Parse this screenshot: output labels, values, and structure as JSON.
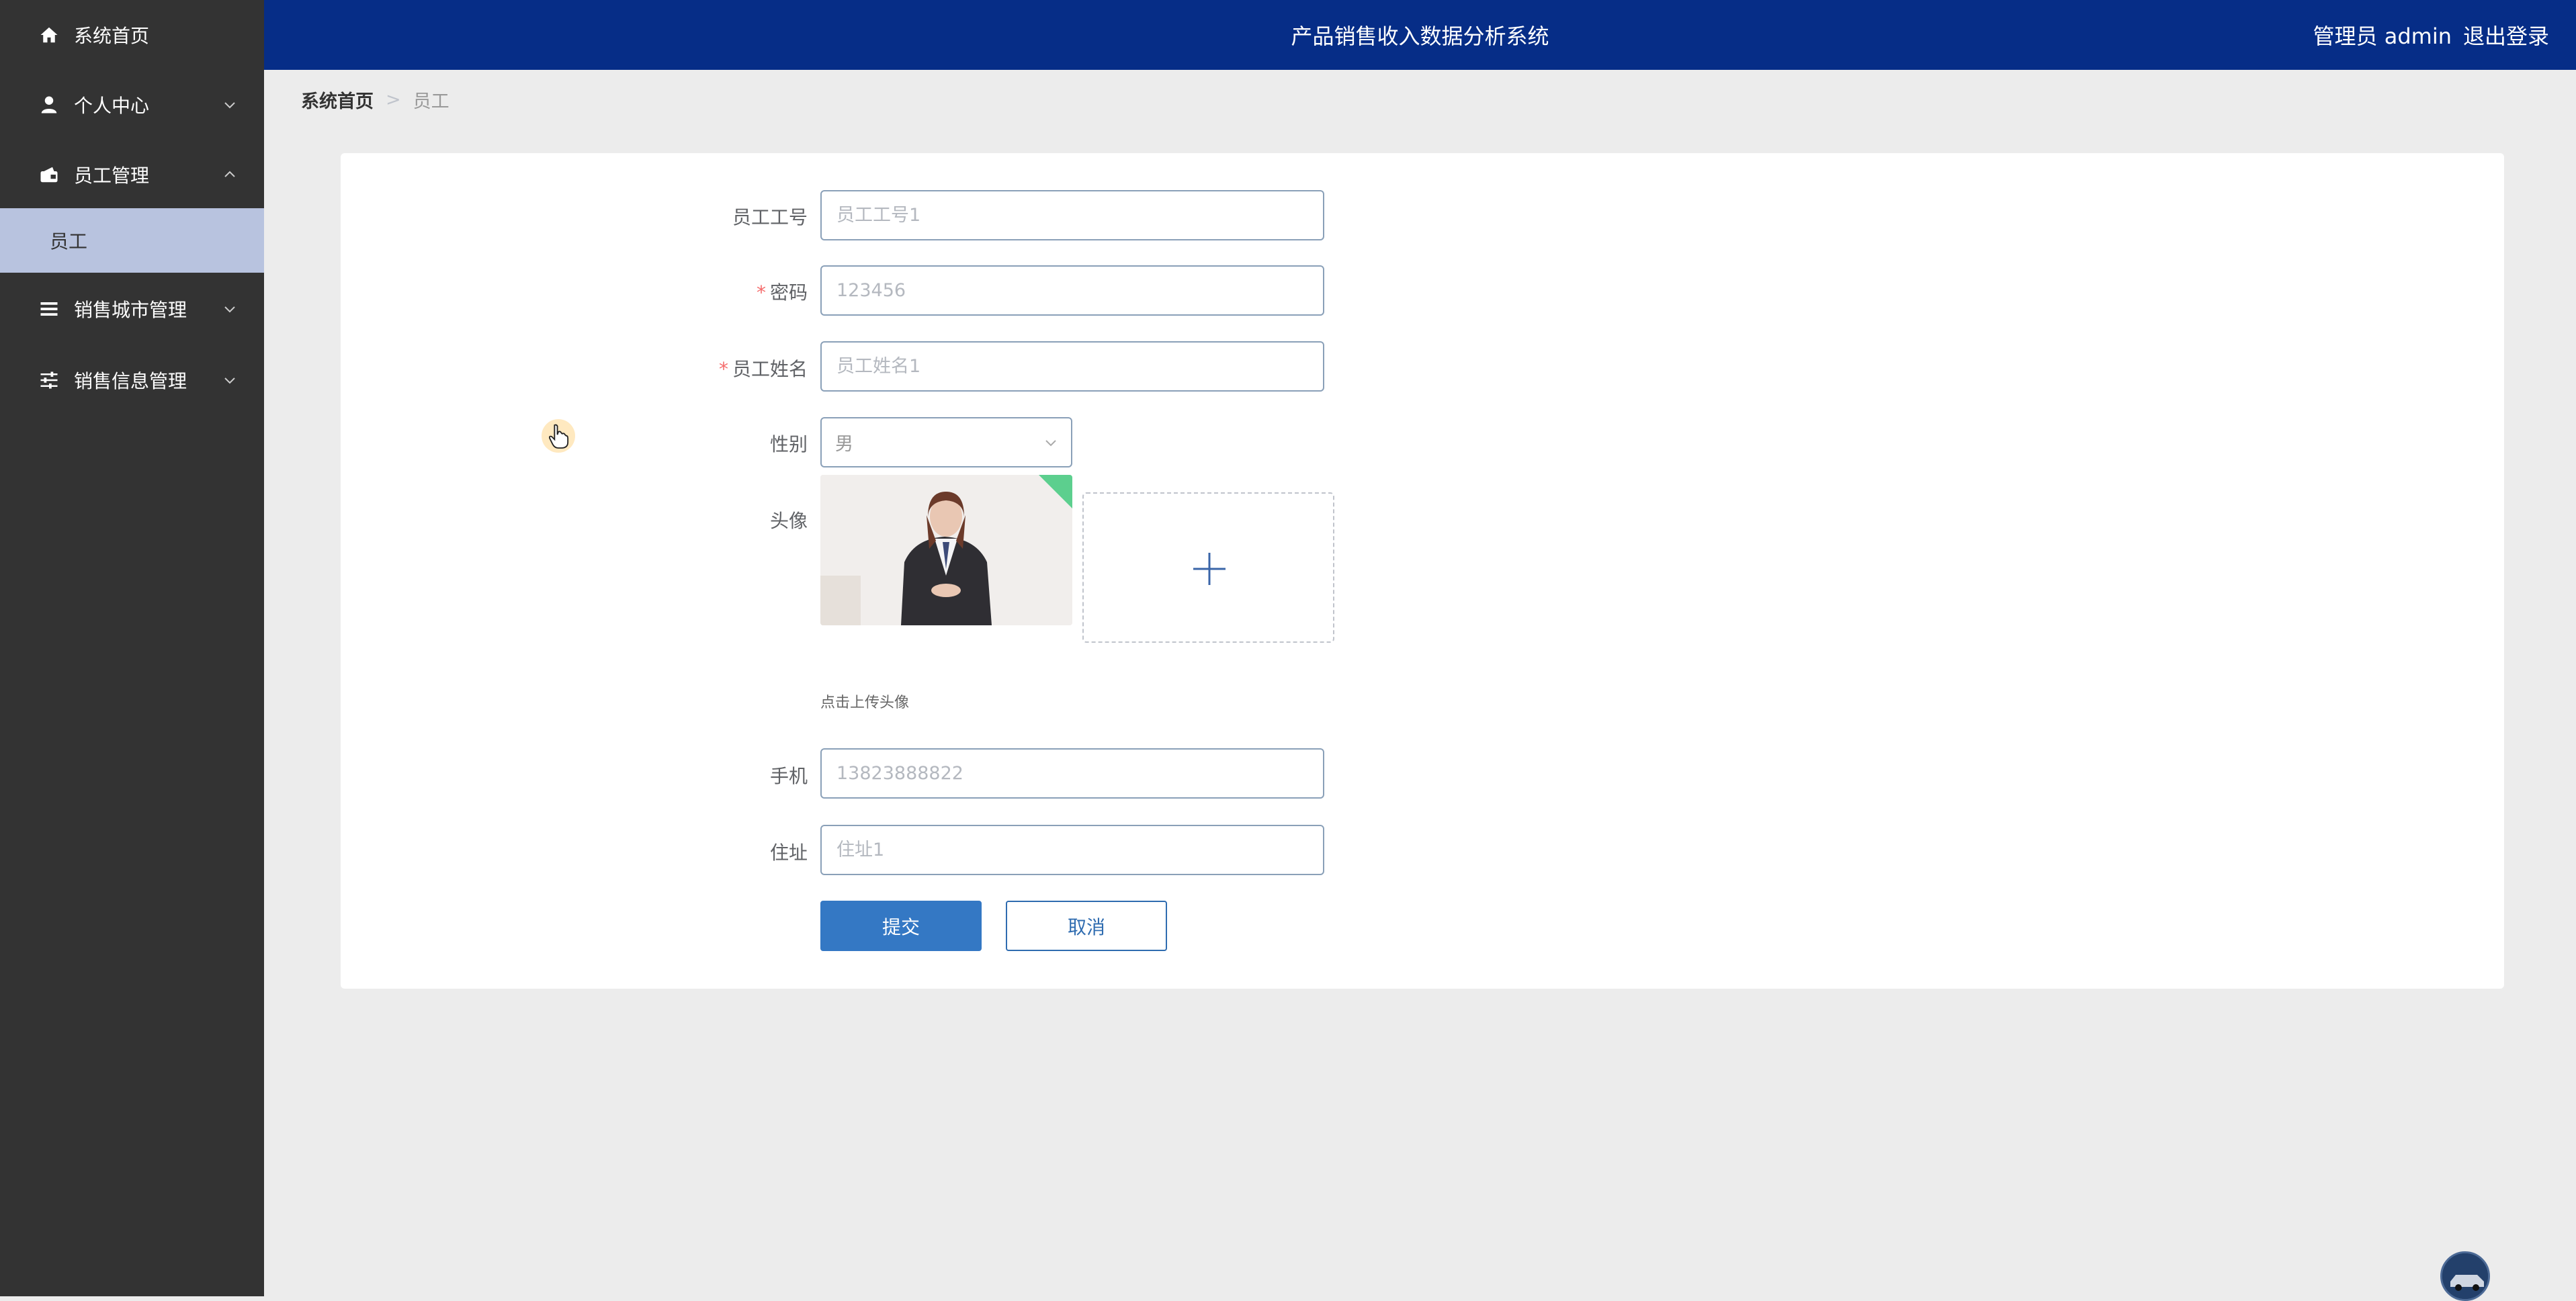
{
  "app": {
    "title": "产品销售收入数据分析系统",
    "user_text": "管理员 admin",
    "logout_label": "退出登录"
  },
  "sidebar": {
    "items": [
      {
        "label": "系统首页",
        "icon": "home-icon"
      },
      {
        "label": "个人中心",
        "icon": "user-icon"
      },
      {
        "label": "员工管理",
        "icon": "wallet-icon"
      },
      {
        "label": "销售城市管理",
        "icon": "list-icon"
      },
      {
        "label": "销售信息管理",
        "icon": "sliders-icon"
      }
    ],
    "submenu": {
      "label": "员工"
    }
  },
  "breadcrumb": {
    "home": "系统首页",
    "separator": ">",
    "current": "员工"
  },
  "form": {
    "employee_id": {
      "label": "员工工号",
      "placeholder": "员工工号1"
    },
    "password": {
      "label": "密码",
      "required_mark": "*",
      "placeholder": "123456"
    },
    "employee_name": {
      "label": "员工姓名",
      "required_mark": "*",
      "placeholder": "员工姓名1"
    },
    "gender": {
      "label": "性别",
      "value": "男"
    },
    "avatar": {
      "label": "头像",
      "upload_hint": "点击上传头像"
    },
    "phone": {
      "label": "手机",
      "placeholder": "13823888822"
    },
    "address": {
      "label": "住址",
      "placeholder": "住址1"
    },
    "submit_label": "提交",
    "cancel_label": "取消"
  },
  "colors": {
    "sidebar_bg": "#333333",
    "topbar_bg": "#062d87",
    "submenu_active_bg": "#b8c3df",
    "primary": "#3478c4",
    "required": "#f56c6c"
  }
}
